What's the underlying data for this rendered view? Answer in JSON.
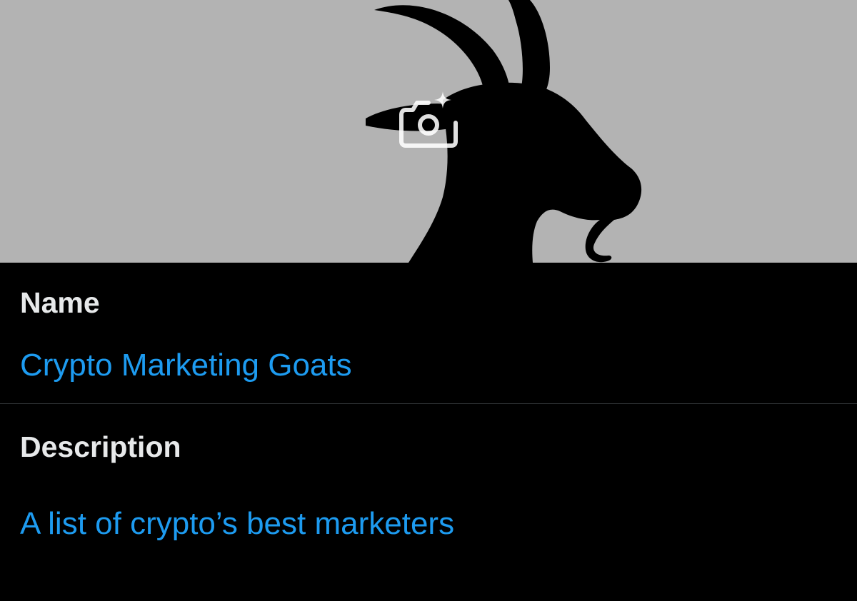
{
  "header": {
    "banner_background": "#b3b3b3",
    "banner_subject_icon": "goat-silhouette-icon",
    "change_photo_icon": "camera-plus-icon"
  },
  "form": {
    "name": {
      "label": "Name",
      "value": "Crypto Marketing Goats"
    },
    "description": {
      "label": "Description",
      "value": "A list of crypto’s best marketers"
    }
  },
  "colors": {
    "background": "#000000",
    "label": "#e7e9ea",
    "accent": "#1d9bf0",
    "divider": "#2f3336"
  }
}
